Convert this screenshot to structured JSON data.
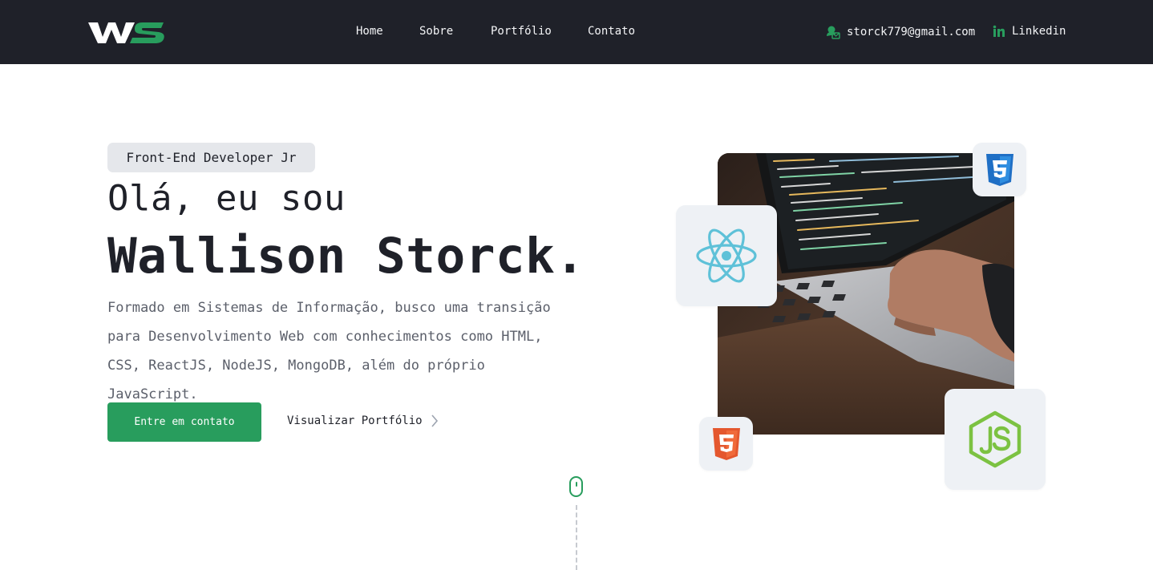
{
  "header": {
    "logo_alt": "WS",
    "nav": [
      {
        "label": "Home"
      },
      {
        "label": "Sobre"
      },
      {
        "label": "Portfólio"
      },
      {
        "label": "Contato"
      }
    ],
    "email": "storck779@gmail.com",
    "linkedin": "Linkedin"
  },
  "hero": {
    "badge": "Front-End Developer Jr",
    "greeting": "Olá, eu sou",
    "name": "Wallison Storck.",
    "description": "Formado em Sistemas de Informação, busco uma transição para Desenvolvimento Web com conhecimentos como HTML, CSS, ReactJS, NodeJS, MongoDB, além do próprio JavaScript.",
    "primary_button": "Entre em contato",
    "secondary_link": "Visualizar Portfólio"
  },
  "tech_icons": [
    "react-icon",
    "css3-icon",
    "html5-icon",
    "nodejs-icon"
  ],
  "colors": {
    "header_bg": "#1f2129",
    "accent": "#289d5d",
    "badge_bg": "#e5e7eb",
    "card_bg": "#eef1f5"
  }
}
